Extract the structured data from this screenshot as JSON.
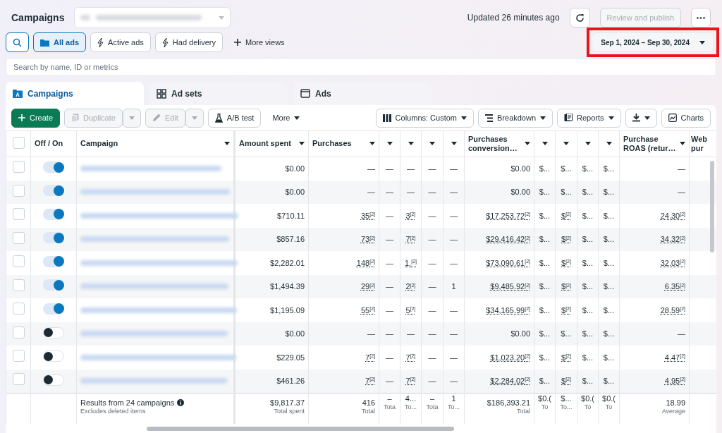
{
  "header": {
    "title": "Campaigns",
    "updated": "Updated 26 minutes ago",
    "review_button": {
      "label": "Review and publish",
      "disabled": true
    }
  },
  "views": [
    {
      "label": "All ads",
      "selected": true
    },
    {
      "label": "Active ads",
      "selected": false
    },
    {
      "label": "Had delivery",
      "selected": false
    }
  ],
  "more_views": {
    "label": "More views"
  },
  "date_range": {
    "label": "Sep 1, 2024 – Sep 30, 2024",
    "highlighted": true
  },
  "search": {
    "placeholder": "Search by name, ID or metrics"
  },
  "tabs": [
    {
      "label": "Campaigns",
      "selected": true
    },
    {
      "label": "Ad sets",
      "selected": false
    },
    {
      "label": "Ads",
      "selected": false
    }
  ],
  "toolbar": {
    "create": {
      "label": "Create"
    },
    "duplicate": {
      "label": "Duplicate",
      "disabled": true
    },
    "edit": {
      "label": "Edit",
      "disabled": true
    },
    "ab_test": {
      "label": "A/B test"
    },
    "more": {
      "label": "More"
    },
    "columns": {
      "label": "Columns: Custom"
    },
    "breakdown": {
      "label": "Breakdown"
    },
    "reports": {
      "label": "Reports"
    },
    "charts": {
      "label": "Charts"
    }
  },
  "table": {
    "select_all": {
      "checked": false
    },
    "fixed_columns": [
      {
        "label": "Off / On",
        "sortable": false
      },
      {
        "label": "Campaign",
        "sortable": true
      }
    ],
    "columns": [
      {
        "label": "Amount spent",
        "sortable": true
      },
      {
        "label": "Purchases",
        "sortable": true
      },
      {
        "sortable": true
      },
      {
        "sortable": true
      },
      {
        "sortable": true
      },
      {
        "sortable": true
      },
      {
        "label": "Purchases conversion…",
        "sortable": true
      },
      {
        "sortable": true
      },
      {
        "sortable": true
      },
      {
        "sortable": true
      },
      {
        "sortable": true
      },
      {
        "label": "Purchase ROAS (retur…",
        "sortable": true
      },
      {
        "label": "Web pur",
        "sortable": false
      }
    ],
    "rows": [
      {
        "checked": false,
        "on": true,
        "cells": [
          "$0.00",
          "—",
          "—",
          "—",
          "—",
          "—",
          "$0.00",
          "$...",
          "$...",
          "$...",
          "$...",
          "—"
        ]
      },
      {
        "checked": false,
        "on": true,
        "cells": [
          "$0.00",
          "—",
          "—",
          "—",
          "—",
          "—",
          "$0.00",
          "$...",
          "$...",
          "$...",
          "$...",
          "—"
        ]
      },
      {
        "checked": false,
        "on": true,
        "cells": [
          "$710.11",
          "35$^{[2]}$",
          "—",
          "3$^{[2]}$",
          "—",
          "—",
          "$17,253.72$^{[2]}$",
          "$...",
          "$$^{[2]}$",
          "$...",
          "$...",
          "24.30$^{[2]}$"
        ]
      },
      {
        "checked": false,
        "on": true,
        "cells": [
          "$857.16",
          "73$^{[2]}$",
          "—",
          "7$^{[2]}$",
          "—",
          "—",
          "$29,416.42$^{[2]}$",
          "$...",
          "$$^{[2]}$",
          "$...",
          "$...",
          "34.32$^{[2]}$"
        ]
      },
      {
        "checked": false,
        "on": true,
        "cells": [
          "$2,282.01",
          "148$^{[2]}$",
          "—",
          "1.$^{[2]}$",
          "—",
          "—",
          "$73,090.61$^{[2]}$",
          "$...",
          "$$^{[2]}$",
          "$...",
          "$...",
          "32.03$^{[2]}$"
        ]
      },
      {
        "checked": false,
        "on": true,
        "cells": [
          "$1,494.39",
          "29$^{[2]}$",
          "—",
          "2$^{[2]}$",
          "—",
          "1",
          "$9,485.92$^{[2]}$",
          "$...",
          "$$^{[2]}$",
          "$...",
          "$...",
          "6.35$^{[2]}$"
        ]
      },
      {
        "checked": false,
        "on": true,
        "cells": [
          "$1,195.09",
          "55$^{[2]}$",
          "—",
          "5$^{[2]}$",
          "—",
          "—",
          "$34,165.99$^{[2]}$",
          "$...",
          "$$^{[2]}$",
          "$...",
          "$...",
          "28.59$^{[2]}$"
        ]
      },
      {
        "checked": false,
        "on": false,
        "cells": [
          "$0.00",
          "—",
          "—",
          "—",
          "—",
          "—",
          "$0.00",
          "$...",
          "$...",
          "$...",
          "$...",
          "—"
        ]
      },
      {
        "checked": false,
        "on": false,
        "cells": [
          "$229.05",
          "7$^{[2]}$",
          "—",
          "7$^{[2]}$",
          "—",
          "—",
          "$1,023.20$^{[2]}$",
          "$...",
          "$$^{[2]}$",
          "$...",
          "$...",
          "4.47$^{[2]}$"
        ]
      },
      {
        "checked": false,
        "on": false,
        "cells": [
          "$461.26",
          "7$^{[2]}$",
          "—",
          "7$^{[2]}$",
          "—",
          "—",
          "$2,284.02$^{[2]}$",
          "$...",
          "$$^{[2]}$",
          "$...",
          "$...",
          "4.95$^{[2]}$"
        ]
      }
    ],
    "footer": {
      "title": "Results from 24 campaigns",
      "note": "Excludes deleted items",
      "totals": [
        {
          "value": "$9,817.37",
          "label": "Total spent"
        },
        {
          "value": "416",
          "label": "Total"
        },
        {
          "value": "–",
          "label": "Tota"
        },
        {
          "value": "4...",
          "label": "To..."
        },
        {
          "value": "–",
          "label": "Tota"
        },
        {
          "value": "1",
          "label": "To..."
        },
        {
          "value": "$186,393.21",
          "label": "Total"
        },
        {
          "value": "$0.(",
          "label": "To"
        },
        {
          "value": "$...",
          "label": "To..."
        },
        {
          "value": "$0.(",
          "label": "To"
        },
        {
          "value": "$0.(",
          "label": "To"
        },
        {
          "value": "18.99",
          "label": "Average"
        }
      ]
    }
  }
}
